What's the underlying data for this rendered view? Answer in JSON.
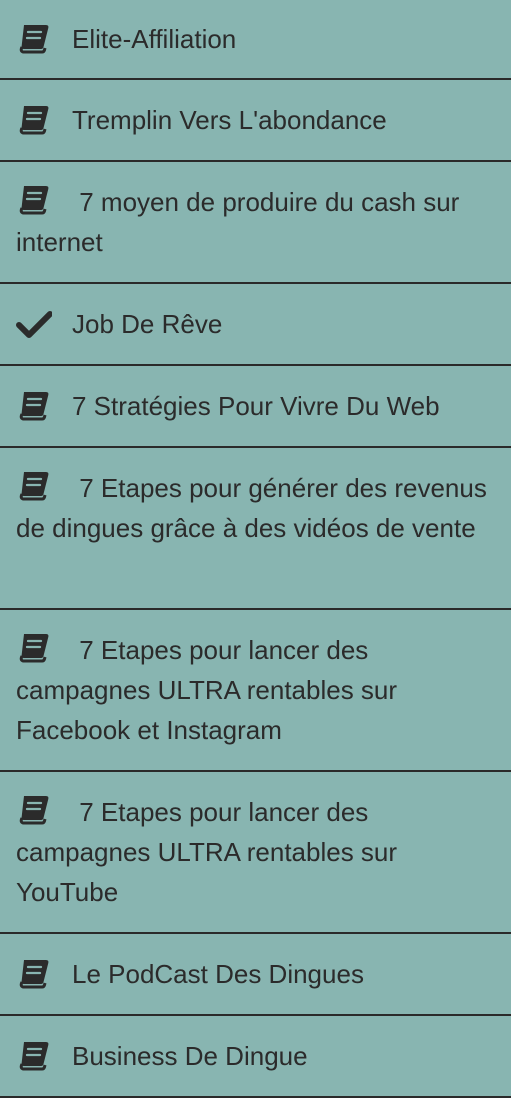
{
  "menu": {
    "items": [
      {
        "label": "Elite-Affiliation",
        "icon": "book-icon"
      },
      {
        "label": "Tremplin Vers L'abondance",
        "icon": "book-icon"
      },
      {
        "label": "7 moyen de produire du cash sur internet",
        "icon": "book-icon"
      },
      {
        "label": "Job De Rêve",
        "icon": "check-icon"
      },
      {
        "label": "7 Stratégies Pour Vivre Du Web",
        "icon": "book-icon"
      },
      {
        "label": "7 Etapes pour générer des revenus de dingues grâce à des vidéos de vente",
        "icon": "book-icon"
      },
      {
        "label": "7 Etapes pour lancer des campagnes ULTRA rentables sur Facebook et Instagram",
        "icon": "book-icon"
      },
      {
        "label": "7 Etapes pour lancer des campagnes ULTRA rentables sur YouTube",
        "icon": "book-icon"
      },
      {
        "label": "Le PodCast Des Dingues",
        "icon": "book-icon"
      },
      {
        "label": "Business De Dingue",
        "icon": "book-icon"
      }
    ]
  },
  "colors": {
    "background": "#88b5b1",
    "text": "#2b2b2b",
    "divider": "#2a2a2a"
  }
}
